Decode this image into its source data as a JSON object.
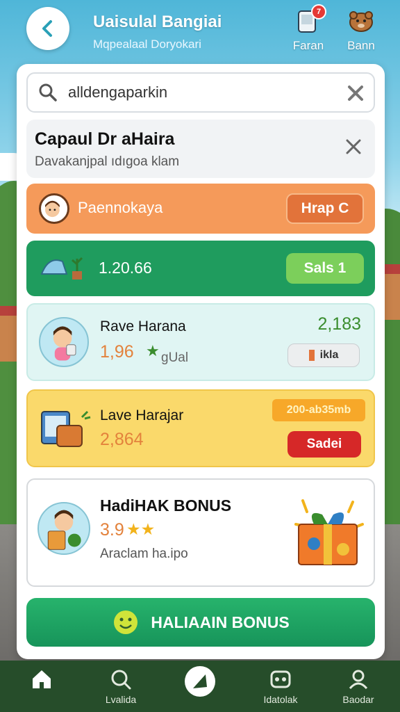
{
  "header": {
    "title": "Uaisulal Bangiai",
    "subtitle": "Mqpealaal Doryokari",
    "actions": [
      {
        "label": "Faran",
        "icon": "notification-device-icon",
        "badge": "7"
      },
      {
        "label": "Bann",
        "icon": "animal-icon"
      }
    ]
  },
  "search": {
    "value": "alldengaparkin"
  },
  "info_card": {
    "title": "Capaul Dr aHaira",
    "subtitle": "Davakanjpal ıdıgoa klam"
  },
  "rows": [
    {
      "label": "Paennokaya",
      "button": "Hrap C"
    },
    {
      "value": "1.20.66",
      "button": "Sals 1"
    },
    {
      "title": "Rave Harana",
      "amount": "2,183",
      "rating": "1,96",
      "rating_suffix": "gUal",
      "button": "ikla"
    },
    {
      "title": "Lave Harajar",
      "value": "2,864",
      "tag": "200-ab35mb",
      "button": "Sadei"
    },
    {
      "title": "HadiHAK BONUS",
      "rating": "3.9",
      "stars": "★★",
      "subtitle": "Araclam ha.ipo"
    }
  ],
  "bottom_cta": {
    "label": "HALIAAIN BONUS"
  },
  "nav": [
    {
      "label": "",
      "icon": "home-icon"
    },
    {
      "label": "Lvalida",
      "icon": "search-icon"
    },
    {
      "label": "",
      "icon": "compass-icon"
    },
    {
      "label": "Idatolak",
      "icon": "gamepad-icon"
    },
    {
      "label": "Baodar",
      "icon": "profile-icon"
    }
  ],
  "colors": {
    "orange": "#f59a5a",
    "green": "#1f9c5e",
    "mint": "#e0f5f3",
    "yellow": "#fad96b",
    "red_button": "#d62828",
    "amount_green": "#3a8d2e"
  }
}
